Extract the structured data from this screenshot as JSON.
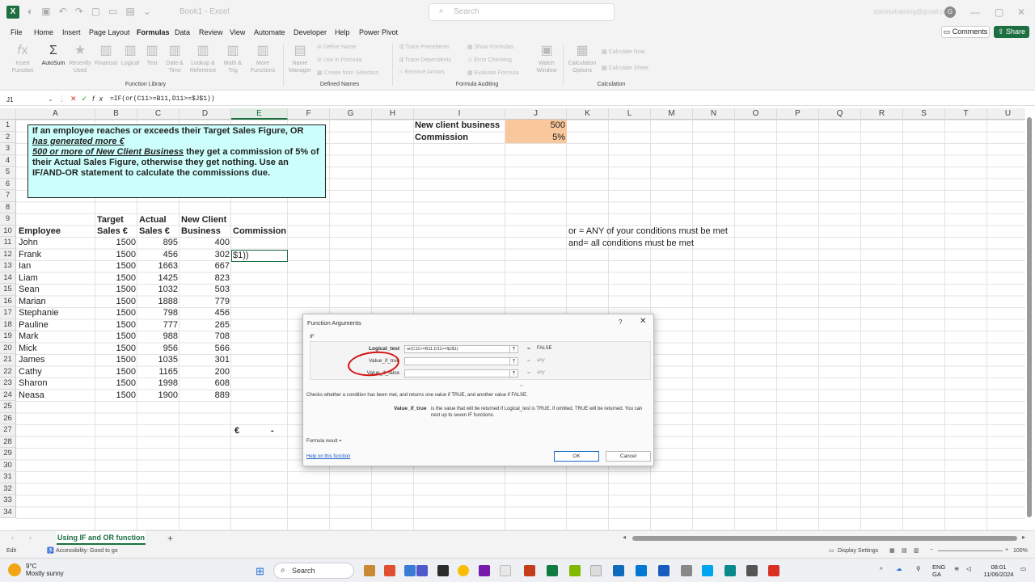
{
  "titlebar": {
    "title": "Book1 - Excel",
    "search_placeholder": "Search",
    "account": "spicesxtraining@gmail.com",
    "avatar_letter": "G"
  },
  "menu": {
    "tabs": [
      "File",
      "Home",
      "Insert",
      "Page Layout",
      "Formulas",
      "Data",
      "Review",
      "View",
      "Automate",
      "Developer",
      "Help",
      "Power Pivot"
    ],
    "active": "Formulas",
    "comments": "Comments",
    "share": "Share"
  },
  "ribbon": {
    "function_library": {
      "insert_function": "Insert Function",
      "autosum": "AutoSum",
      "recently_used": "Recently Used",
      "financial": "Financial",
      "logical": "Logical",
      "text": "Text",
      "date_time": "Date & Time",
      "lookup_reference": "Lookup & Reference",
      "math_trig": "Math & Trig",
      "more_functions": "More Functions",
      "group_label": "Function Library"
    },
    "defined_names": {
      "name_manager": "Name Manager",
      "define_name": "Define Name",
      "use_in_formula": "Use in Formula",
      "create_from_selection": "Create from Selection",
      "group_label": "Defined Names"
    },
    "formula_auditing": {
      "trace_precedents": "Trace Precedents",
      "trace_dependents": "Trace Dependents",
      "remove_arrows": "Remove Arrows",
      "show_formulas": "Show Formulas",
      "error_checking": "Error Checking",
      "evaluate_formula": "Evaluate Formula",
      "watch_window": "Watch Window",
      "group_label": "Formula Auditing"
    },
    "calculation": {
      "calculation_options": "Calculation Options",
      "calculate_now": "Calculate Now",
      "calculate_sheet": "Calculate Sheet",
      "group_label": "Calculation"
    }
  },
  "formula_bar": {
    "name_box": "J1",
    "formula": "=IF(or(C11>=B11,D11>=$J$1))"
  },
  "grid": {
    "columns": [
      "A",
      "B",
      "C",
      "D",
      "E",
      "F",
      "G",
      "H",
      "I",
      "J",
      "K",
      "L",
      "M",
      "N",
      "O",
      "P",
      "Q",
      "R",
      "S",
      "T",
      "U"
    ],
    "selected_column": "E",
    "rows": [
      "1",
      "2",
      "3",
      "4",
      "5",
      "6",
      "7",
      "8",
      "9",
      "10",
      "11",
      "12",
      "13",
      "14",
      "15",
      "16",
      "17",
      "18",
      "19",
      "20",
      "21",
      "22",
      "23",
      "24",
      "25",
      "26",
      "27",
      "28",
      "29",
      "30",
      "31",
      "32",
      "33",
      "34"
    ]
  },
  "instructions": {
    "line1": "If an employee reaches or exceeds their Target Sales Figure, OR ",
    "line1_u": "has generated more €",
    "line2_u": "500 or more of New Client Business",
    "line2": " they get a commission of 5% of their Actual Sales Figure, otherwise they get nothing.  Use an IF/AND-OR statement to calculate the commissions due."
  },
  "params": {
    "new_client_label": "New client business",
    "new_client_value": "500",
    "commission_label": "Commission",
    "commission_value": "5%"
  },
  "headers": {
    "employee": "Employee",
    "target": "Target",
    "target2": "Sales €",
    "actual": "Actual",
    "actual2": "Sales €",
    "newclient": "New Client",
    "newclient2": "Business",
    "commission": "Commission"
  },
  "active_cell_text": "$1))",
  "employees": [
    {
      "name": "John",
      "target": "1500",
      "actual": "895",
      "new_client": "400"
    },
    {
      "name": "Frank",
      "target": "1500",
      "actual": "456",
      "new_client": "302"
    },
    {
      "name": "Ian",
      "target": "1500",
      "actual": "1663",
      "new_client": "667"
    },
    {
      "name": "Liam",
      "target": "1500",
      "actual": "1425",
      "new_client": "823"
    },
    {
      "name": "Sean",
      "target": "1500",
      "actual": "1032",
      "new_client": "503"
    },
    {
      "name": "Marian",
      "target": "1500",
      "actual": "1888",
      "new_client": "779"
    },
    {
      "name": "Stephanie",
      "target": "1500",
      "actual": "798",
      "new_client": "456"
    },
    {
      "name": "Pauline",
      "target": "1500",
      "actual": "777",
      "new_client": "265"
    },
    {
      "name": "Mark",
      "target": "1500",
      "actual": "988",
      "new_client": "708"
    },
    {
      "name": "Mick",
      "target": "1500",
      "actual": "956",
      "new_client": "566"
    },
    {
      "name": "James",
      "target": "1500",
      "actual": "1035",
      "new_client": "301"
    },
    {
      "name": "Cathy",
      "target": "1500",
      "actual": "1165",
      "new_client": "200"
    },
    {
      "name": "Sharon",
      "target": "1500",
      "actual": "1998",
      "new_client": "608"
    },
    {
      "name": "Neasa",
      "target": "1500",
      "actual": "1900",
      "new_client": "889"
    }
  ],
  "total": {
    "symbol": "€",
    "value": "-"
  },
  "notes": {
    "or_note": "or = ANY of your conditions must be met",
    "and_note": "and= all conditions must be met"
  },
  "dialog": {
    "title": "Function Arguments",
    "help_glyph": "?",
    "close_glyph": "✕",
    "function": "IF",
    "args": [
      {
        "label": "Logical_test",
        "value": "or(C11>=B11,D11>=$J$1)",
        "result": "FALSE"
      },
      {
        "label": "Value_if_true",
        "value": "",
        "result": "any"
      },
      {
        "label": "Value_if_false",
        "value": "",
        "result": "any"
      }
    ],
    "eq": "=",
    "description": "Checks whether a condition has been met, and returns one value if TRUE, and another value if FALSE.",
    "current_arg": "Value_if_true",
    "current_arg_desc": "is the value that will be returned if Logical_test is TRUE. If omitted, TRUE will be returned. You can nest up to seven IF functions.",
    "formula_result": "Formula result =",
    "help_link": "Help on this function",
    "ok": "OK",
    "cancel": "Cancel"
  },
  "sheet": {
    "tab": "Using IF and OR function"
  },
  "status": {
    "mode": "Edit",
    "accessibility": "Accessibility: Good to go",
    "display_settings": "Display Settings",
    "zoom": "100%"
  },
  "taskbar": {
    "temp": "9°C",
    "weather": "Mostly sunny",
    "search": "Search",
    "lang": "ENG",
    "region": "GA",
    "time": "08:01",
    "date": "11/06/2024"
  }
}
